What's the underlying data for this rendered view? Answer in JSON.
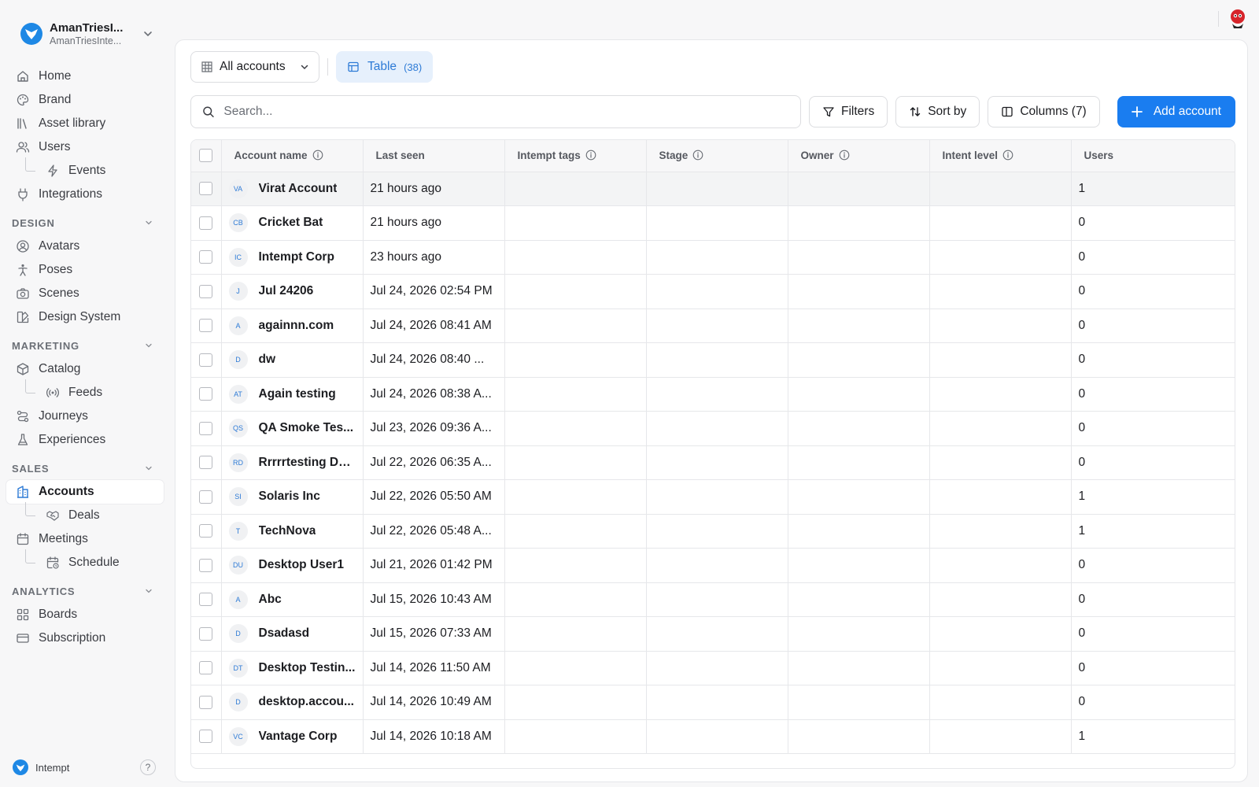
{
  "workspace": {
    "name": "AmanTriesI...",
    "subtitle": "AmanTriesInte..."
  },
  "nav": {
    "top": [
      {
        "label": "Home",
        "icon": "home-icon"
      },
      {
        "label": "Brand",
        "icon": "palette-icon"
      },
      {
        "label": "Asset library",
        "icon": "library-icon"
      },
      {
        "label": "Users",
        "icon": "users-icon"
      },
      {
        "label": "Events",
        "icon": "lightning-icon",
        "sub": true
      },
      {
        "label": "Integrations",
        "icon": "plug-icon"
      }
    ],
    "sections": [
      {
        "title": "DESIGN",
        "items": [
          {
            "label": "Avatars",
            "icon": "avatar-icon"
          },
          {
            "label": "Poses",
            "icon": "pose-icon"
          },
          {
            "label": "Scenes",
            "icon": "camera-icon"
          },
          {
            "label": "Design System",
            "icon": "design-system-icon"
          }
        ]
      },
      {
        "title": "MARKETING",
        "items": [
          {
            "label": "Catalog",
            "icon": "box-icon"
          },
          {
            "label": "Feeds",
            "icon": "broadcast-icon",
            "sub": true
          },
          {
            "label": "Journeys",
            "icon": "journey-icon"
          },
          {
            "label": "Experiences",
            "icon": "flask-icon"
          }
        ]
      },
      {
        "title": "SALES",
        "items": [
          {
            "label": "Accounts",
            "icon": "building-icon",
            "active": true
          },
          {
            "label": "Deals",
            "icon": "handshake-icon",
            "sub": true
          },
          {
            "label": "Meetings",
            "icon": "calendar-icon"
          },
          {
            "label": "Schedule",
            "icon": "calendar-clock-icon",
            "sub": true
          }
        ]
      },
      {
        "title": "ANALYTICS",
        "items": [
          {
            "label": "Boards",
            "icon": "grid-icon"
          },
          {
            "label": "Subscription",
            "icon": "card-icon"
          }
        ]
      }
    ]
  },
  "footer": {
    "brand": "Intempt",
    "help": "?"
  },
  "views": {
    "selected": "All accounts",
    "tab_label": "Table",
    "tab_count": "(38)"
  },
  "toolbar": {
    "search_placeholder": "Search...",
    "filters": "Filters",
    "sort": "Sort by",
    "columns": "Columns (7)",
    "add": "Add account"
  },
  "colors": {
    "accent": "#1a7df0",
    "accent_soft": "#e6f0fc",
    "badge_text": "#2e7bd6"
  },
  "table": {
    "columns": [
      "Account name",
      "Last seen",
      "Intempt tags",
      "Stage",
      "Owner",
      "Intent level",
      "Users"
    ],
    "rows": [
      {
        "initials": "VA",
        "name": "Virat Account",
        "last_seen": "21 hours ago",
        "users": "1"
      },
      {
        "initials": "CB",
        "name": "Cricket Bat",
        "last_seen": "21 hours ago",
        "users": "0"
      },
      {
        "initials": "IC",
        "name": "Intempt Corp",
        "last_seen": "23 hours ago",
        "users": "0"
      },
      {
        "initials": "J",
        "name": "Jul 24206",
        "last_seen": "Jul 24, 2026 02:54 PM",
        "users": "0"
      },
      {
        "initials": "A",
        "name": "againnn.com",
        "last_seen": "Jul 24, 2026 08:41 AM",
        "users": "0"
      },
      {
        "initials": "D",
        "name": "dw",
        "last_seen": "Jul 24, 2026 08:40 ...",
        "users": "0"
      },
      {
        "initials": "AT",
        "name": "Again testing",
        "last_seen": "Jul 24, 2026 08:38 A...",
        "users": "0"
      },
      {
        "initials": "QS",
        "name": "QA Smoke Tes...",
        "last_seen": "Jul 23, 2026 09:36 A...",
        "users": "0"
      },
      {
        "initials": "RD",
        "name": "Rrrrrtesting De...",
        "last_seen": "Jul 22, 2026 06:35 A...",
        "users": "0"
      },
      {
        "initials": "SI",
        "name": "Solaris Inc",
        "last_seen": "Jul 22, 2026 05:50 AM",
        "users": "1"
      },
      {
        "initials": "T",
        "name": "TechNova",
        "last_seen": "Jul 22, 2026 05:48 A...",
        "users": "1"
      },
      {
        "initials": "DU",
        "name": "Desktop User1",
        "last_seen": "Jul 21, 2026 01:42 PM",
        "users": "0"
      },
      {
        "initials": "A",
        "name": "Abc",
        "last_seen": "Jul 15, 2026 10:43 AM",
        "users": "0"
      },
      {
        "initials": "D",
        "name": "Dsadasd",
        "last_seen": "Jul 15, 2026 07:33 AM",
        "users": "0"
      },
      {
        "initials": "DT",
        "name": "Desktop Testin...",
        "last_seen": "Jul 14, 2026 11:50 AM",
        "users": "0"
      },
      {
        "initials": "D",
        "name": "desktop.accou...",
        "last_seen": "Jul 14, 2026 10:49 AM",
        "users": "0"
      },
      {
        "initials": "VC",
        "name": "Vantage Corp",
        "last_seen": "Jul 14, 2026 10:18 AM",
        "users": "1"
      }
    ]
  }
}
